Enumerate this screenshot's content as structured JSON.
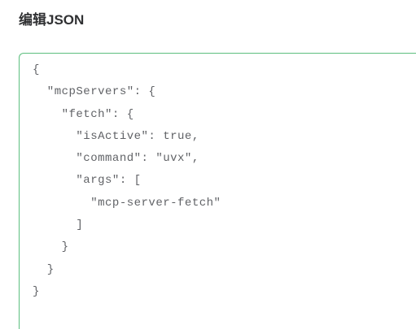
{
  "header": {
    "title": "编辑JSON"
  },
  "editor": {
    "value": "{\n  \"mcpServers\": {\n    \"fetch\": {\n      \"isActive\": true,\n      \"command\": \"uvx\",\n      \"args\": [\n        \"mcp-server-fetch\"\n      ]\n    }\n  }\n}"
  },
  "colors": {
    "focus_border": "#5cbf7e",
    "text": "#606266"
  }
}
